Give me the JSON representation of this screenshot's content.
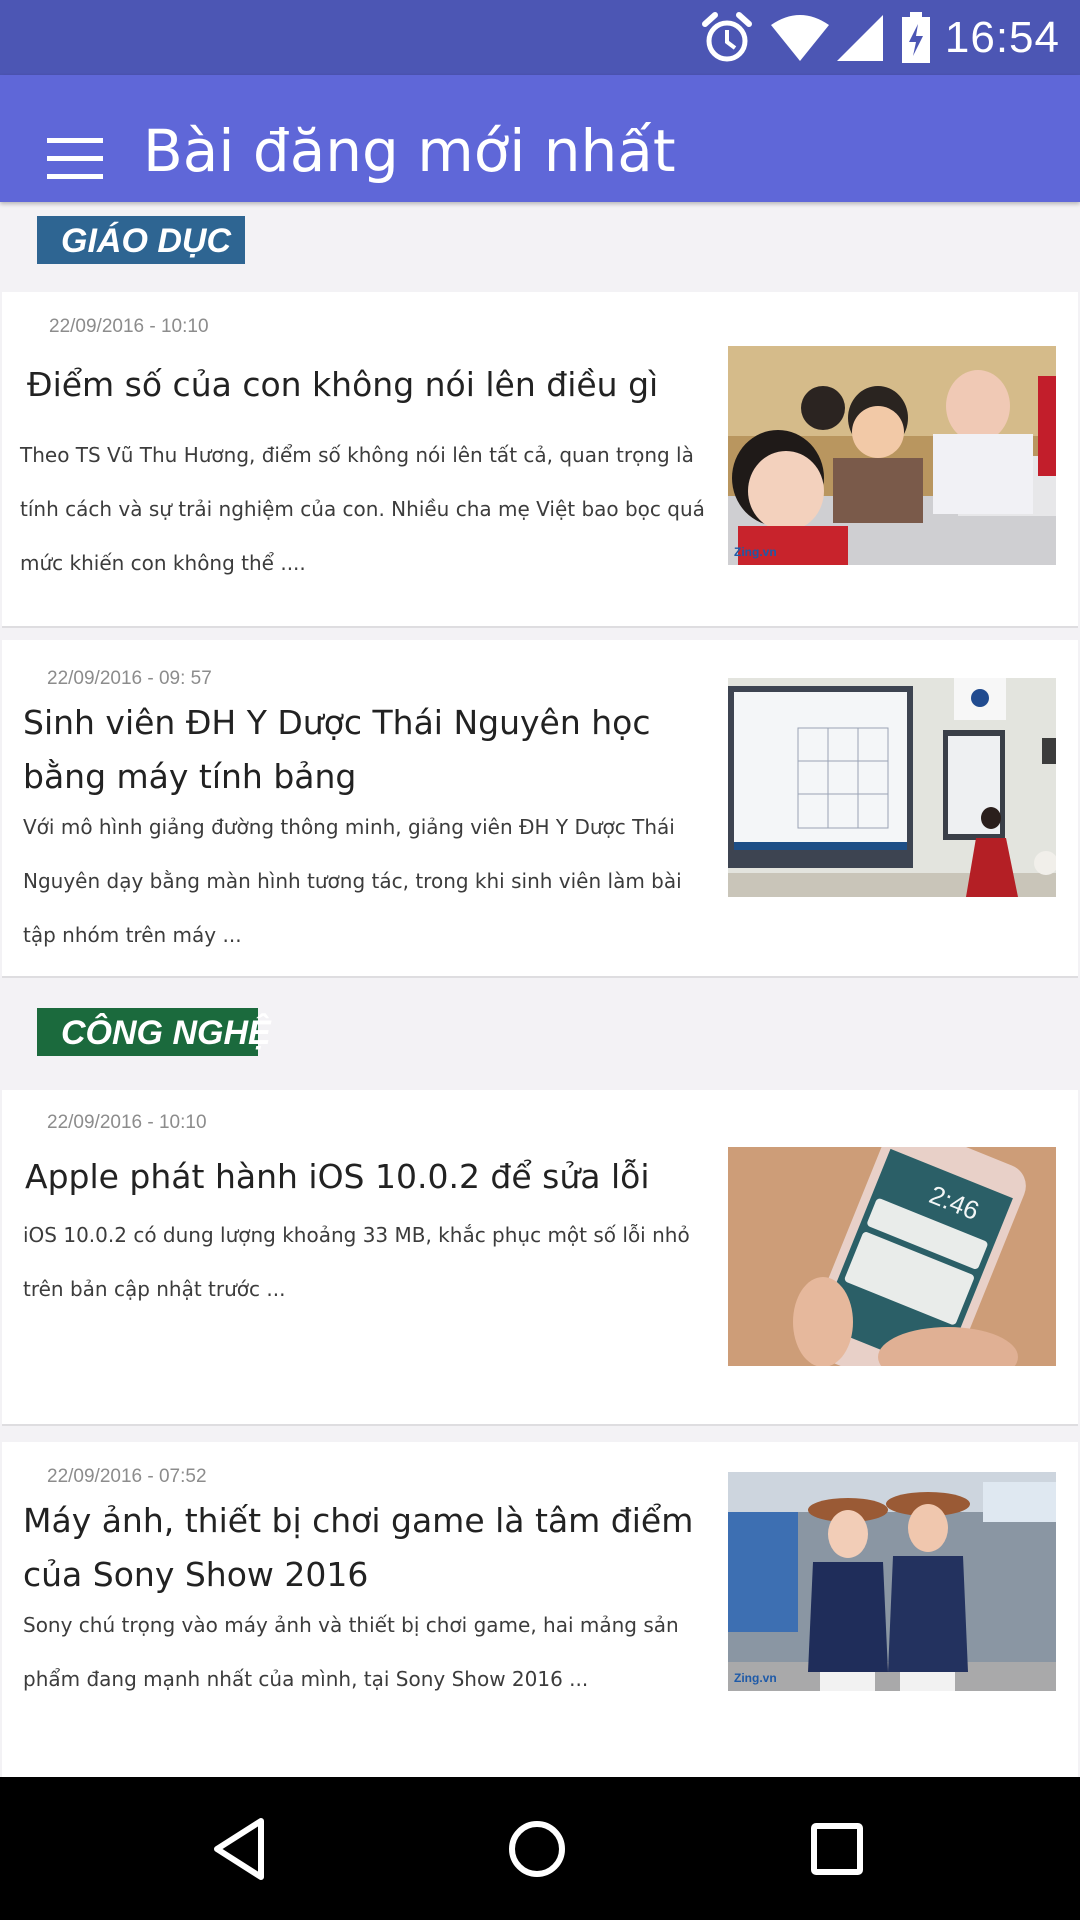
{
  "status_bar": {
    "time": "16:54",
    "icons": [
      "alarm-icon",
      "wifi-icon",
      "signal-icon",
      "battery-charging-icon"
    ]
  },
  "app_bar": {
    "title": "Bài đăng mới nhất",
    "menu_icon": "hamburger-menu-icon"
  },
  "categories": [
    {
      "label": "GIÁO DỤC",
      "color": "#2e6592"
    },
    {
      "label": "CÔNG NGHỆ",
      "color": "#1b6a3d"
    }
  ],
  "articles": [
    {
      "date": "22/09/2016 - 10:10",
      "title": "Điểm số của con không nói lên điều gì",
      "summary": "Theo TS Vũ Thu Hương, điểm số không nói lên tất cả, quan trọng là tính cách và sự trải nghiệm của con. Nhiều cha mẹ Việt bao bọc quá mức khiến con không thể ....",
      "image": "children-classroom-photo"
    },
    {
      "date": "22/09/2016 - 09: 57",
      "title": "Sinh viên ĐH Y Dược Thái Nguyên học bằng máy tính bảng",
      "summary": "Với mô hình giảng đường thông minh, giảng viên ĐH Y Dược Thái Nguyên dạy bằng màn hình tương tác, trong khi sinh viên làm bài tập nhóm trên máy ...",
      "image": "smart-classroom-photo"
    },
    {
      "date": "22/09/2016 - 10:10",
      "title": "Apple phát hành iOS 10.0.2 để sửa lỗi",
      "summary": "iOS 10.0.2 có dung lượng khoảng 33 MB, khắc phục một số lỗi nhỏ trên bản cập nhật trước ...",
      "image": "iphone-lockscreen-photo"
    },
    {
      "date": "22/09/2016 - 07:52",
      "title": "Máy ảnh, thiết bị chơi game là tâm điểm của Sony Show 2016",
      "summary": "Sony chú trọng vào máy ảnh và thiết bị chơi game, hai mảng sản phẩm đang mạnh nhất của mình, tại Sony Show 2016 ...",
      "image": "sony-show-models-photo"
    }
  ],
  "nav_bar": {
    "buttons": [
      "back-icon",
      "home-icon",
      "recents-icon"
    ]
  }
}
